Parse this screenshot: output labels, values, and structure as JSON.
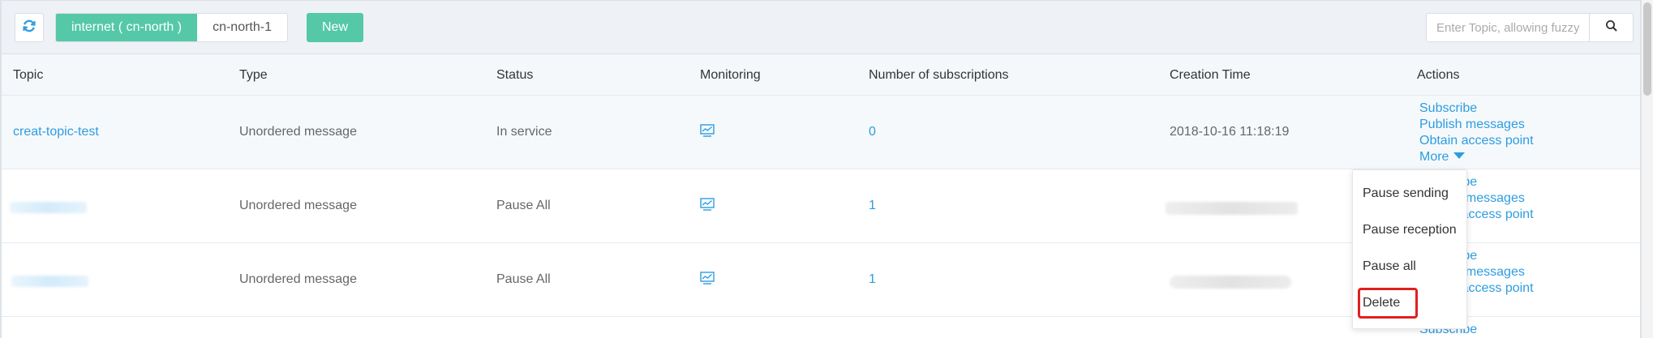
{
  "toolbar": {
    "regions": [
      {
        "label": "internet ( cn-north )",
        "active": true
      },
      {
        "label": "cn-north-1",
        "active": false
      }
    ],
    "new_label": "New",
    "search_placeholder": "Enter Topic, allowing fuzzy"
  },
  "columns": [
    "Topic",
    "Type",
    "Status",
    "Monitoring",
    "Number of subscriptions",
    "Creation Time",
    "Actions"
  ],
  "rows": [
    {
      "topic": "creat-topic-test",
      "type": "Unordered message",
      "status": "In service",
      "subscriptions": "0",
      "created": "2018-10-16 11:18:19",
      "actions": [
        "Subscribe",
        "Publish messages",
        "Obtain access point"
      ],
      "more_label": "More"
    },
    {
      "topic": "",
      "type": "Unordered message",
      "status": "Pause All",
      "subscriptions": "1",
      "created": "",
      "actions": [
        "Subscribe",
        "Publish messages",
        "Obtain access point"
      ]
    },
    {
      "topic": "",
      "type": "Unordered message",
      "status": "Pause All",
      "subscriptions": "1",
      "created": "",
      "actions": [
        "Subscribe",
        "Publish messages",
        "Obtain access point"
      ]
    }
  ],
  "last_row_partial_action": "Subscribe",
  "more_menu": {
    "items": [
      "Pause sending",
      "Pause reception",
      "Pause all",
      "Delete"
    ],
    "highlighted": "Delete"
  },
  "colors": {
    "accent_green": "#54c8a7",
    "link_blue": "#2d9de0",
    "highlight_red": "#e02020"
  },
  "icons": {
    "refresh": "refresh-icon",
    "search": "search-icon",
    "monitoring": "monitoring-chart-icon",
    "more": "caret-down-icon"
  }
}
